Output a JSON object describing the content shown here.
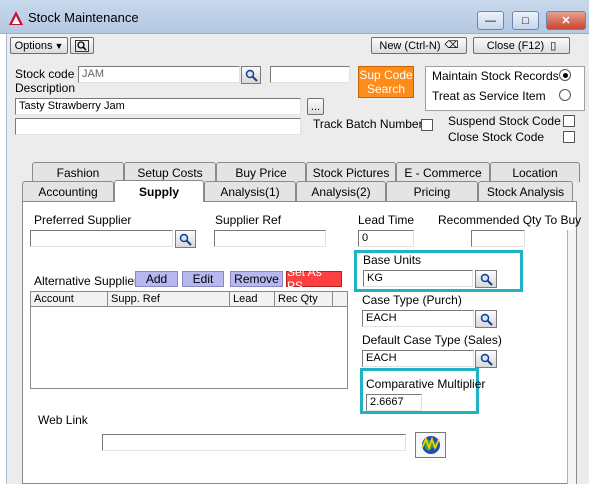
{
  "window": {
    "title": "Stock Maintenance"
  },
  "toolbar": {
    "options_label": "Options",
    "new_label": "New (Ctrl-N)",
    "close_label": "Close (F12)"
  },
  "header": {
    "stock_code_label": "Stock code",
    "stock_code_value": "JAM",
    "description_label": "Description",
    "description_value": "Tasty Strawberry Jam",
    "description2_value": "",
    "sup_code_search": "Sup Code\nSearch",
    "sup_code_line1": "Sup Code",
    "sup_code_line2": "Search",
    "ellipsis": "...",
    "track_batch_label": "Track Batch Numbers",
    "maintain_label": "Maintain Stock Records",
    "service_label": "Treat as Service Item",
    "suspend_label": "Suspend Stock Code",
    "close_stock_label": "Close Stock Code"
  },
  "tabs_row1": [
    "Fashion",
    "Setup Costs",
    "Buy Price",
    "Stock Pictures",
    "E - Commerce",
    "Location"
  ],
  "tabs_row2": [
    "Accounting",
    "Supply",
    "Analysis(1)",
    "Analysis(2)",
    "Pricing",
    "Stock Analysis"
  ],
  "supply": {
    "preferred_supplier_label": "Preferred Supplier",
    "preferred_supplier_value": "",
    "supplier_ref_label": "Supplier Ref",
    "supplier_ref_value": "",
    "lead_time_label": "Lead Time",
    "lead_time_value": "0",
    "recommended_qty_label": "Recommended Qty To Buy",
    "recommended_qty_value": "",
    "alt_suppliers_label": "Alternative Suppliers",
    "add_label": "Add",
    "edit_label": "Edit",
    "remove_label": "Remove",
    "set_as_ps_label": "Set As PS",
    "grid_columns": [
      "Account",
      "Supp. Ref",
      "Lead",
      "Rec Qty"
    ],
    "base_units_label": "Base Units",
    "base_units_value": "KG",
    "case_type_label": "Case Type (Purch)",
    "case_type_value": "EACH",
    "default_case_label": "Default Case Type (Sales)",
    "default_case_value": "EACH",
    "comparative_label": "Comparative Multiplier",
    "comparative_value": "2.6667",
    "web_link_label": "Web Link",
    "web_link_value": ""
  },
  "colors": {
    "accent_highlight": "#22b2c8",
    "sup_code_button": "#ff8c1a",
    "set_as_ps": "#ff4040",
    "action_button": "#b8b8f0"
  }
}
